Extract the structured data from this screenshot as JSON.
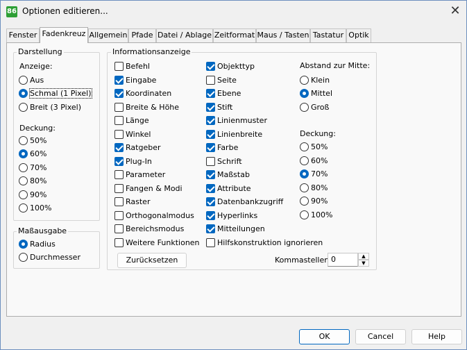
{
  "window": {
    "title": "Optionen editieren...",
    "app_icon": "86",
    "close_icon": "✕"
  },
  "tabs": [
    "Fenster",
    "Fadenkreuz",
    "Allgemein",
    "Pfade",
    "Datei / Ablage",
    "Zeitformat",
    "Maus / Tasten",
    "Tastatur",
    "Optik"
  ],
  "active_tab": "Fadenkreuz",
  "darstellung": {
    "title": "Darstellung",
    "anzeige_label": "Anzeige:",
    "anzeige_options": [
      "Aus",
      "Schmal (1 Pixel)",
      "Breit (3 Pixel)"
    ],
    "anzeige_selected": "Schmal (1 Pixel)",
    "deckung_label": "Deckung:",
    "deckung_options": [
      "50%",
      "60%",
      "70%",
      "80%",
      "90%",
      "100%"
    ],
    "deckung_selected": "60%"
  },
  "massausgabe": {
    "title": "Maßausgabe",
    "options": [
      "Radius",
      "Durchmesser"
    ],
    "selected": "Radius"
  },
  "info": {
    "title": "Informationsanzeige",
    "col1": [
      {
        "label": "Befehl",
        "checked": false
      },
      {
        "label": "Eingabe",
        "checked": true
      },
      {
        "label": "Koordinaten",
        "checked": true
      },
      {
        "label": "Breite & Höhe",
        "checked": false
      },
      {
        "label": "Länge",
        "checked": false
      },
      {
        "label": "Winkel",
        "checked": false
      },
      {
        "label": "Ratgeber",
        "checked": true
      },
      {
        "label": "Plug-In",
        "checked": true
      },
      {
        "label": "Parameter",
        "checked": false
      },
      {
        "label": "Fangen & Modi",
        "checked": false
      },
      {
        "label": "Raster",
        "checked": false
      },
      {
        "label": "Orthogonalmodus",
        "checked": false
      },
      {
        "label": "Bereichsmodus",
        "checked": false
      },
      {
        "label": "Weitere Funktionen",
        "checked": false
      }
    ],
    "col2": [
      {
        "label": "Objekttyp",
        "checked": true
      },
      {
        "label": "Seite",
        "checked": false
      },
      {
        "label": "Ebene",
        "checked": true
      },
      {
        "label": "Stift",
        "checked": true
      },
      {
        "label": "Linienmuster",
        "checked": true
      },
      {
        "label": "Linienbreite",
        "checked": true
      },
      {
        "label": "Farbe",
        "checked": true
      },
      {
        "label": "Schrift",
        "checked": false
      },
      {
        "label": "Maßstab",
        "checked": true
      },
      {
        "label": "Attribute",
        "checked": true
      },
      {
        "label": "Datenbankzugriff",
        "checked": true
      },
      {
        "label": "Hyperlinks",
        "checked": true
      },
      {
        "label": "Mitteilungen",
        "checked": true
      },
      {
        "label": "Hilfskonstruktion ignorieren",
        "checked": false
      }
    ],
    "abstand_label": "Abstand zur Mitte:",
    "abstand_options": [
      "Klein",
      "Mittel",
      "Groß"
    ],
    "abstand_selected": "Mittel",
    "deckung_label": "Deckung:",
    "deckung_options": [
      "50%",
      "60%",
      "70%",
      "80%",
      "90%",
      "100%"
    ],
    "deckung_selected": "70%",
    "reset_label": "Zurücksetzen",
    "kommastellen_label": "Kommastellen:",
    "kommastellen_value": "0"
  },
  "footer": {
    "ok_label": "OK",
    "cancel_label": "Cancel",
    "help_label": "Help"
  }
}
